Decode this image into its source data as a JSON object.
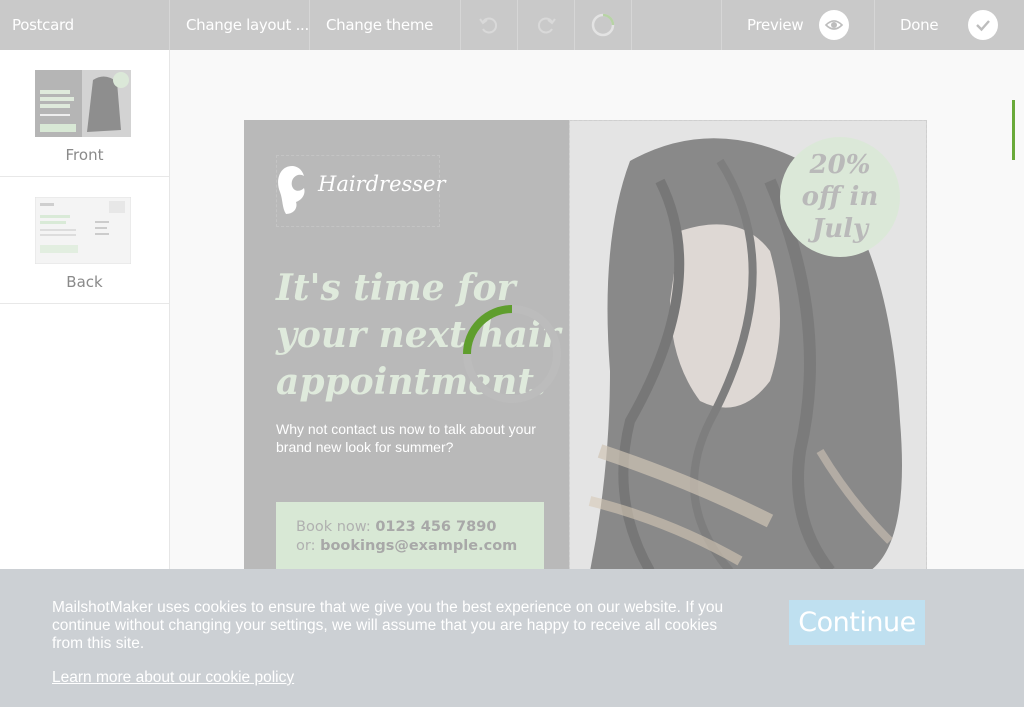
{
  "toolbar": {
    "doc_title": "Postcard",
    "change_layout": "Change layout ...",
    "change_theme": "Change theme",
    "undo_icon": "undo-icon",
    "redo_icon": "redo-icon",
    "spinner_icon": "loading-ring-icon",
    "preview_label": "Preview",
    "preview_icon": "eye-icon",
    "done_label": "Done",
    "done_icon": "check-icon",
    "bg_color": "#c9c9c9"
  },
  "sidebar": {
    "pages": [
      {
        "label": "Front"
      },
      {
        "label": "Back"
      }
    ]
  },
  "postcard": {
    "logo_text": "Hairdresser",
    "headline": [
      "It's time for",
      "your next hair",
      "appointment."
    ],
    "subtext": "Why not contact us now to talk about your brand new look for summer?",
    "contact": {
      "book_prefix": "Book now: ",
      "phone": "0123 456 7890",
      "or_prefix": "or: ",
      "email": "bookings@example.com"
    },
    "offer": [
      "20%",
      "off in",
      "July"
    ],
    "accent_color": "#dfeadc"
  },
  "loader": {
    "progress": 0.25,
    "color": "#5f9e2d"
  },
  "cookie_banner": {
    "message": "MailshotMaker uses cookies to ensure that we give you the best experience on our website. If you continue without changing your settings, we will assume that you are happy to receive all cookies from this site.",
    "link": "Learn more about our cookie policy",
    "button": "Continue",
    "button_color": "#bfe0f0"
  }
}
